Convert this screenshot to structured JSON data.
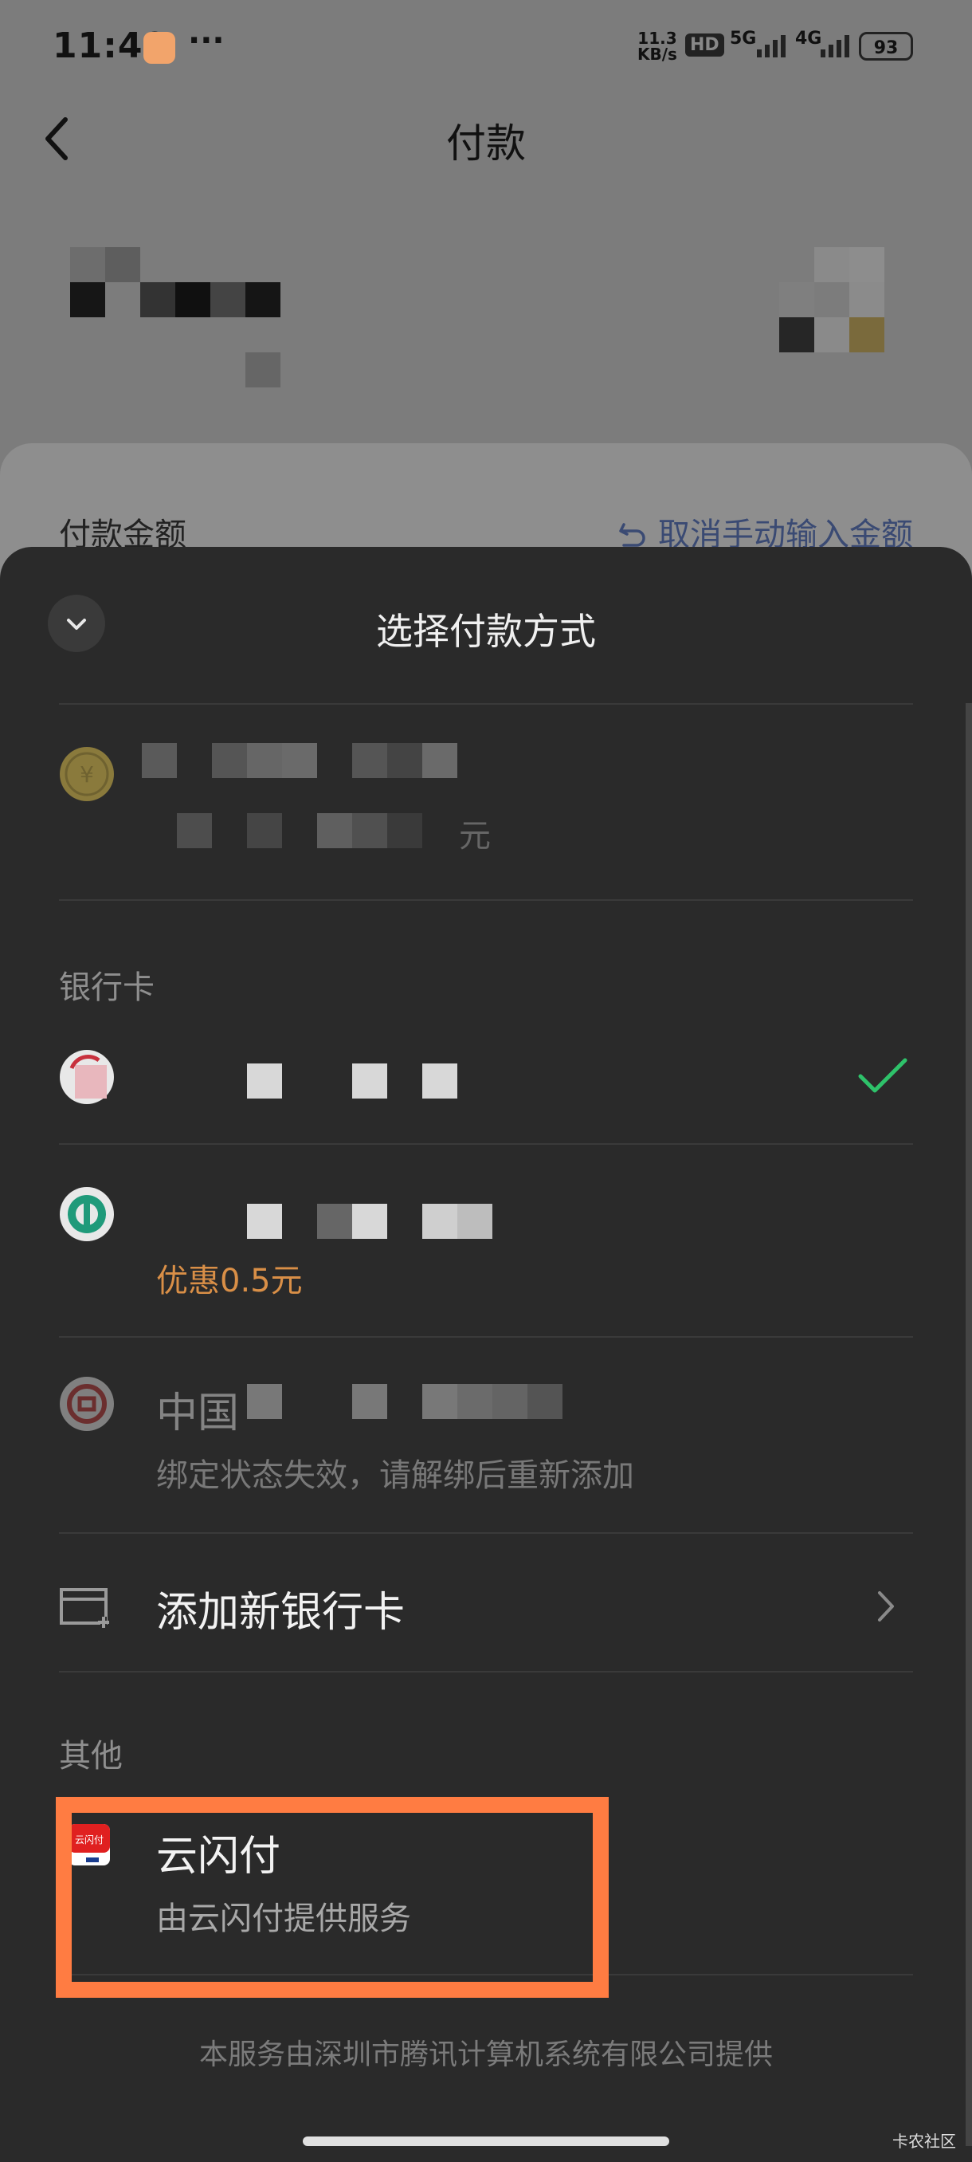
{
  "status_bar": {
    "time": "11:49",
    "dots": "···",
    "speed_value": "11.3",
    "speed_unit": "KB/s",
    "hd": "HD",
    "net1": "5G",
    "net2": "4G",
    "battery": "93"
  },
  "header": {
    "title": "付款"
  },
  "payment": {
    "amount_label": "付款金额",
    "cancel_manual": "取消手动输入金额"
  },
  "sheet": {
    "title": "选择付款方式",
    "balance_sub_suffix": "元",
    "bank_section_label": "银行卡",
    "abc_promo": "优惠0.5元",
    "boc_name_prefix": "中国",
    "boc_status": "绑定状态失效，请解绑后重新添加",
    "add_card": "添加新银行卡",
    "others_label": "其他",
    "unionpay_name": "云闪付",
    "unionpay_sub": "由云闪付提供服务",
    "unionpay_icon_text": "云闪付",
    "footer": "本服务由深圳市腾讯计算机系统有限公司提供"
  },
  "watermark": "卡农社区",
  "colors": {
    "sheet_bg": "#2a2a2a",
    "check_green": "#2ec26a",
    "promo_orange": "#d98f47",
    "highlight_orange": "#ff7c42",
    "overlay_bg": "#7c7c7c"
  },
  "icons": [
    "back-arrow-icon",
    "chevron-down-icon",
    "undo-icon",
    "coin-icon",
    "bank-logo-icon",
    "check-icon",
    "card-add-icon",
    "chevron-right-icon",
    "unionpay-icon"
  ]
}
